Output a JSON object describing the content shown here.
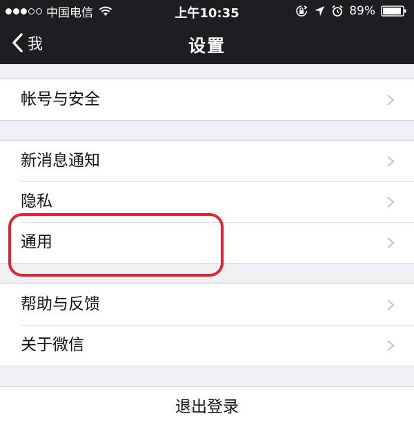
{
  "status_bar": {
    "carrier": "中国电信",
    "time": "上午10:35",
    "battery_percent": "89%",
    "signal_strength": "3 of 5",
    "icons": [
      "wifi-icon",
      "orientation-lock-icon",
      "location-icon",
      "alarm-icon",
      "battery-icon"
    ]
  },
  "nav": {
    "back_label": "我",
    "title": "设置"
  },
  "settings": {
    "group1": [
      {
        "label": "帐号与安全"
      }
    ],
    "group2": [
      {
        "label": "新消息通知"
      },
      {
        "label": "隐私"
      },
      {
        "label": "通用"
      }
    ],
    "group3": [
      {
        "label": "帮助与反馈"
      },
      {
        "label": "关于微信"
      }
    ],
    "logout_label": "退出登录"
  },
  "annotation": {
    "highlight_color": "#e8202a",
    "highlighted_item": "通用"
  },
  "colors": {
    "nav_background": "#1e1d22",
    "page_background": "#efeff4",
    "cell_background": "#ffffff",
    "chevron": "#c7c7cc"
  }
}
